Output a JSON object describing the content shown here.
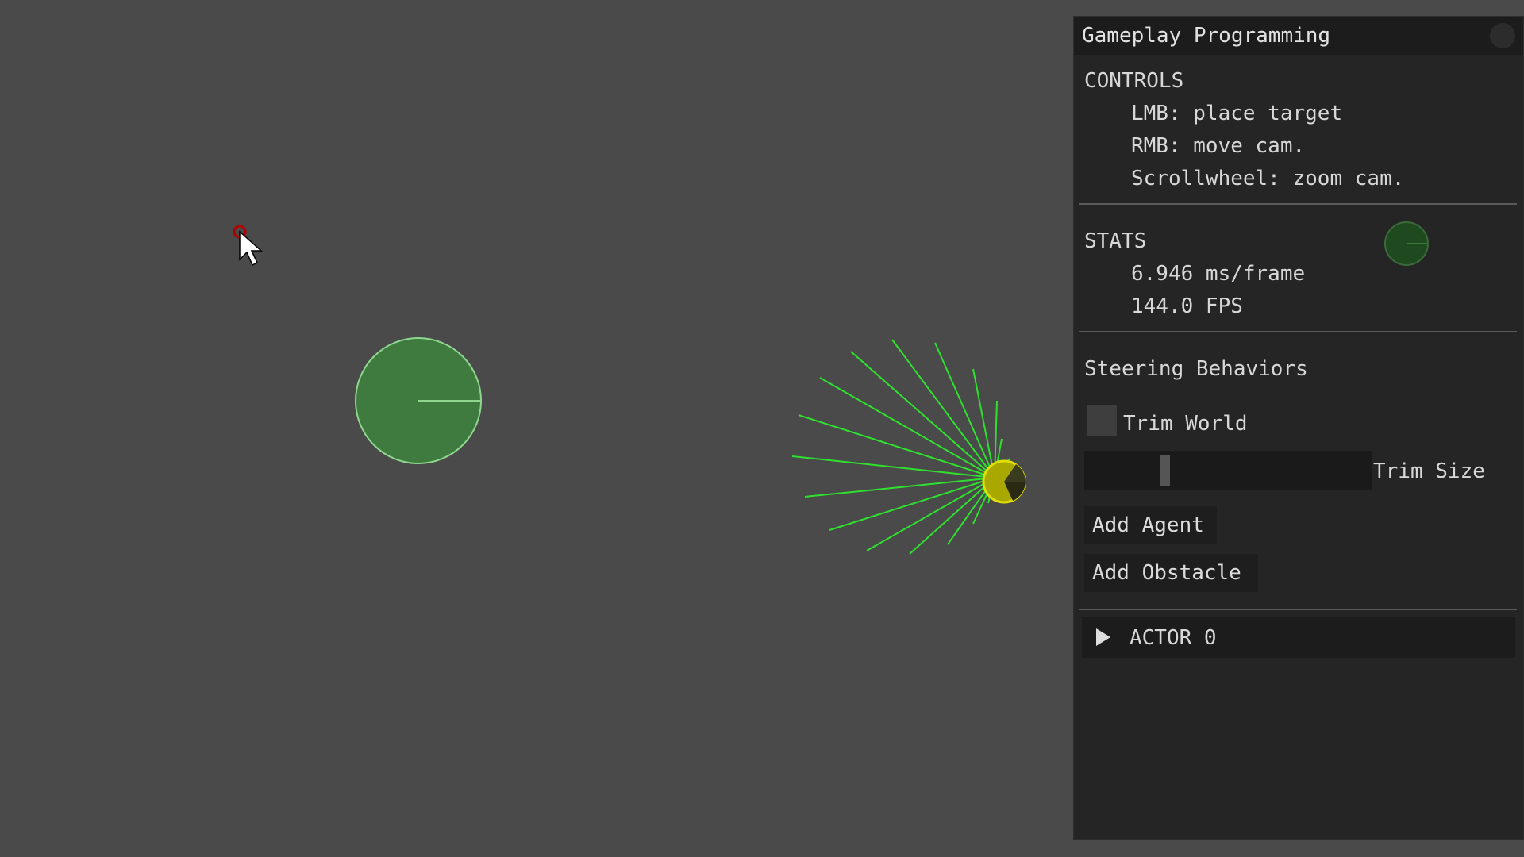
{
  "window": {
    "title": "Gameplay Programming"
  },
  "controls": {
    "header": "CONTROLS",
    "lines": [
      "LMB: place target",
      "RMB: move cam.",
      "Scrollwheel: zoom cam."
    ]
  },
  "stats": {
    "header": "STATS",
    "ms_per_frame": "6.946 ms/frame",
    "fps": "144.0 FPS"
  },
  "steering": {
    "header": "Steering Behaviors",
    "trim_world_label": "Trim World",
    "trim_world_checked": false,
    "trim_size_label": "Trim Size",
    "add_agent_label": "Add Agent",
    "add_obstacle_label": "Add Obstacle"
  },
  "actor_node": {
    "label": "ACTOR 0",
    "expanded": false
  },
  "colors": {
    "background": "#4a4a4a",
    "panel_bg": "#252525",
    "obstacle_fill": "#3f7a3f",
    "obstacle_stroke": "#8ed68e",
    "ray_color": "#2fe02f",
    "agent_color": "#d6d600",
    "target_color": "#b00000"
  }
}
